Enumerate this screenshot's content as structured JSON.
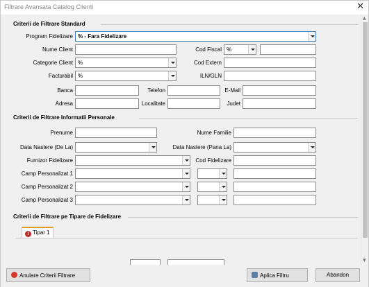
{
  "window": {
    "title": "Filtrare Avansata Catalog Clienti",
    "close_glyph": "✕"
  },
  "sections": {
    "standard": "Criterii de Filtrare Standard",
    "personal": "Criterii de Filtrare Informatii Personale",
    "tipare": "Criterii de Filtrare pe Tipare de Fidelizare"
  },
  "standard": {
    "program_label": "Program Fidelizare",
    "program_value": "% - Fara Fidelizare",
    "nume_label": "Nume Client",
    "nume_value": "",
    "cod_fiscal_label": "Cod Fiscal",
    "cod_fiscal_select": "%",
    "cod_fiscal_value": "",
    "categorie_label": "Categorie Client",
    "categorie_value": "%",
    "cod_extern_label": "Cod Extern",
    "cod_extern_value": "",
    "facturabil_label": "Facturabil",
    "facturabil_value": "%",
    "iln_label": "ILN/GLN",
    "iln_value": "",
    "banca_label": "Banca",
    "telefon_label": "Telefon",
    "email_label": "E-Mail",
    "adresa_label": "Adresa",
    "localitate_label": "Localitate",
    "judet_label": "Judet"
  },
  "personal": {
    "prenume_label": "Prenume",
    "nume_familie_label": "Nume Familie",
    "nastere_de_la_label": "Data Nastere (De La)",
    "nastere_pana_la_label": "Data Nastere (Pana La)",
    "furnizor_label": "Furnizor Fidelizare",
    "cod_fidelizare_label": "Cod Fidelizare",
    "camp1_label": "Camp Personalizat 1",
    "camp2_label": "Camp Personalizat 2",
    "camp3_label": "Camp Personalizat 3"
  },
  "tipare": {
    "tab_label": "Tipar 1"
  },
  "footer": {
    "anulare_label": "Anulare Criterii Filtrare",
    "aplica_label": "Aplica Filtru",
    "abandon_label": "Abandon"
  },
  "colors": {
    "accent_tab": "#e69a1f",
    "error_icon": "#c62828"
  }
}
